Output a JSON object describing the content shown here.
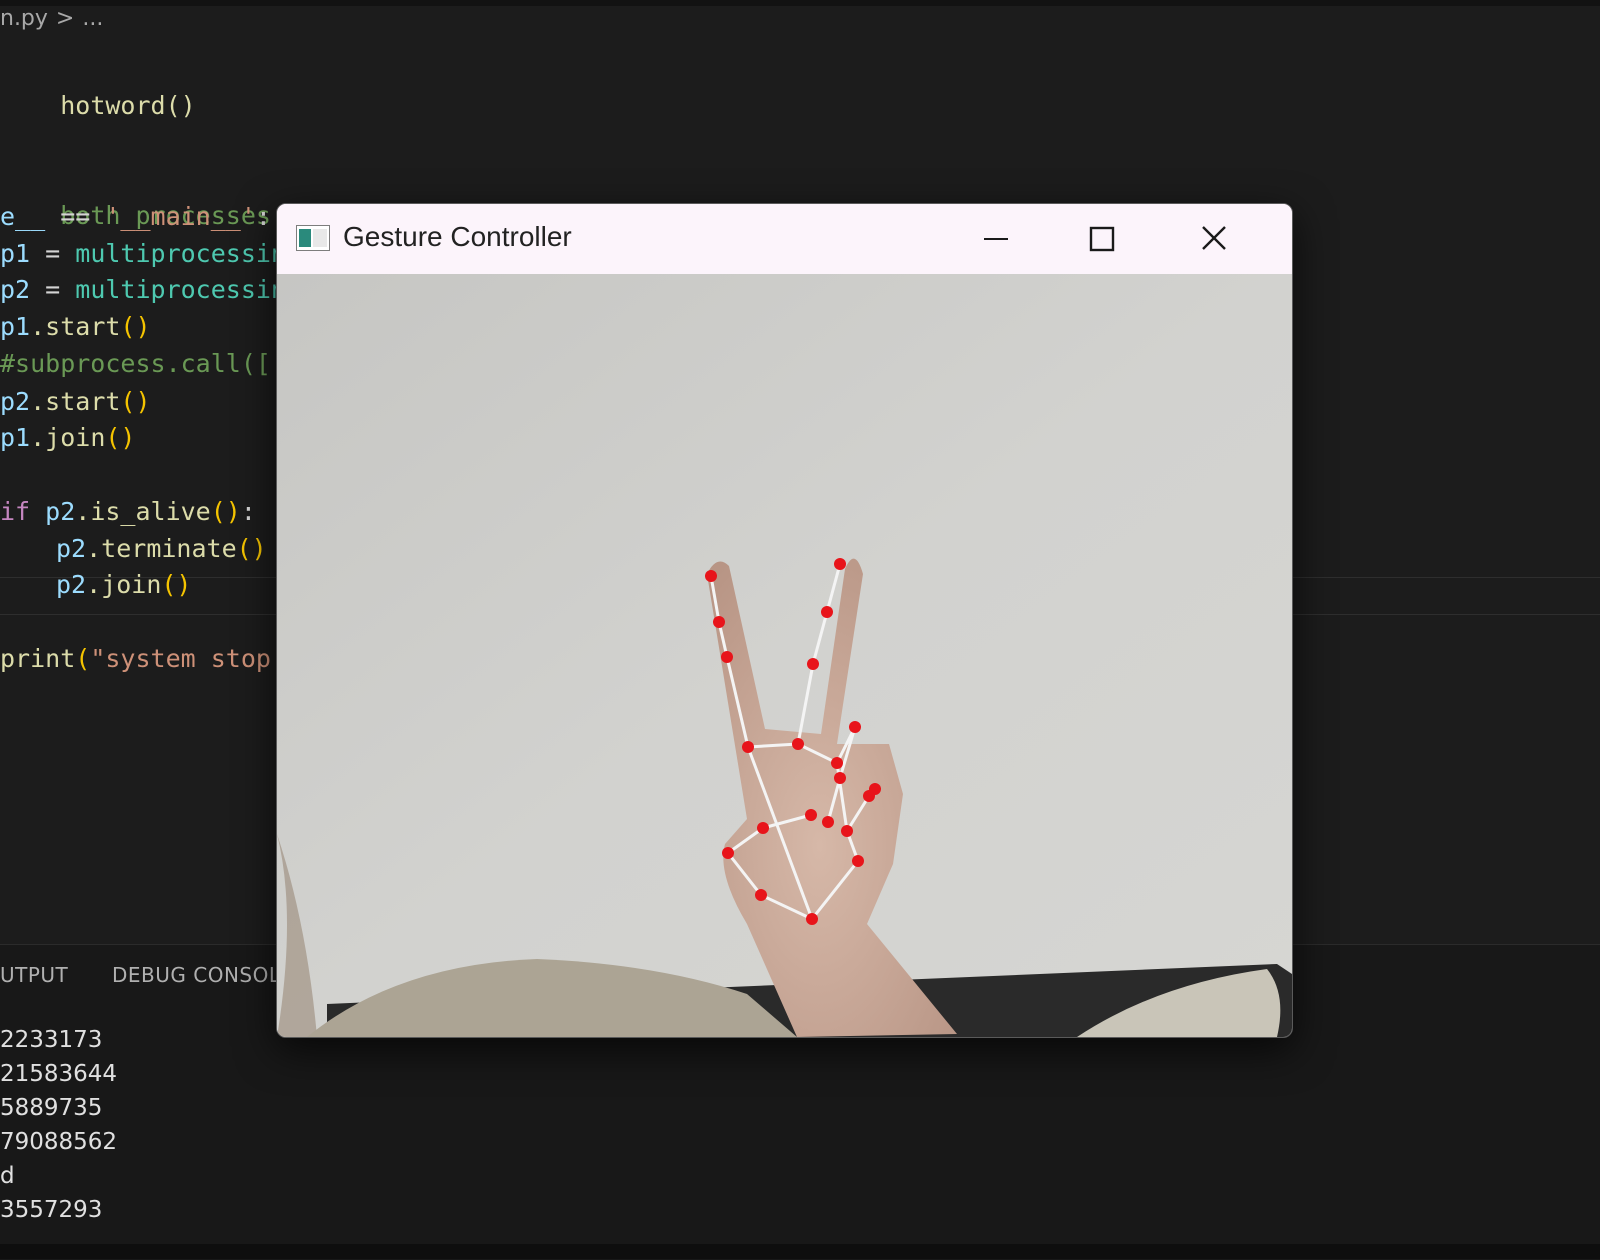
{
  "breadcrumb": {
    "file": "n.py",
    "separator": ">",
    "trail": "..."
  },
  "editor": {
    "lines": {
      "l0": "hotword()",
      "l1": "both processes",
      "l2_a": "e__",
      "l2_b": " == ",
      "l2_c": "'__main__'",
      "l2_d": ":",
      "l3_a": "p1",
      "l3_b": " = ",
      "l3_c": "multiprocessin",
      "l4_a": "p2",
      "l4_b": " = ",
      "l4_c": "multiprocessin",
      "l5_a": "p1",
      "l5_b": ".start",
      "l5_c": "()",
      "l6": "#subprocess.call([",
      "l7_a": "p2",
      "l7_b": ".start",
      "l7_c": "()",
      "l8_a": "p1",
      "l8_b": ".join",
      "l8_c": "()",
      "l9_a": "if",
      "l9_b": " p2",
      "l9_c": ".is_alive",
      "l9_d": "()",
      "l9_e": ":",
      "l10_a": "p2",
      "l10_b": ".terminate",
      "l10_c": "()",
      "l11_a": "p2",
      "l11_b": ".join",
      "l11_c": "()",
      "l12_a": "print",
      "l12_b": "(",
      "l12_c": "\"system stop"
    }
  },
  "panel": {
    "tabs": [
      "UTPUT",
      "DEBUG CONSOLE"
    ],
    "terminal": [
      "2233173",
      "21583644",
      "5889735",
      "79088562",
      "d",
      "3557293"
    ]
  },
  "window": {
    "title": "Gesture Controller",
    "icons": {
      "app": "terminal-window-icon",
      "minimize": "minimize-icon",
      "maximize": "maximize-icon",
      "close": "close-icon"
    },
    "colors": {
      "landmark": "#e8141a",
      "connection": "#f4f4f4",
      "wall": "#cfcfcc"
    }
  }
}
